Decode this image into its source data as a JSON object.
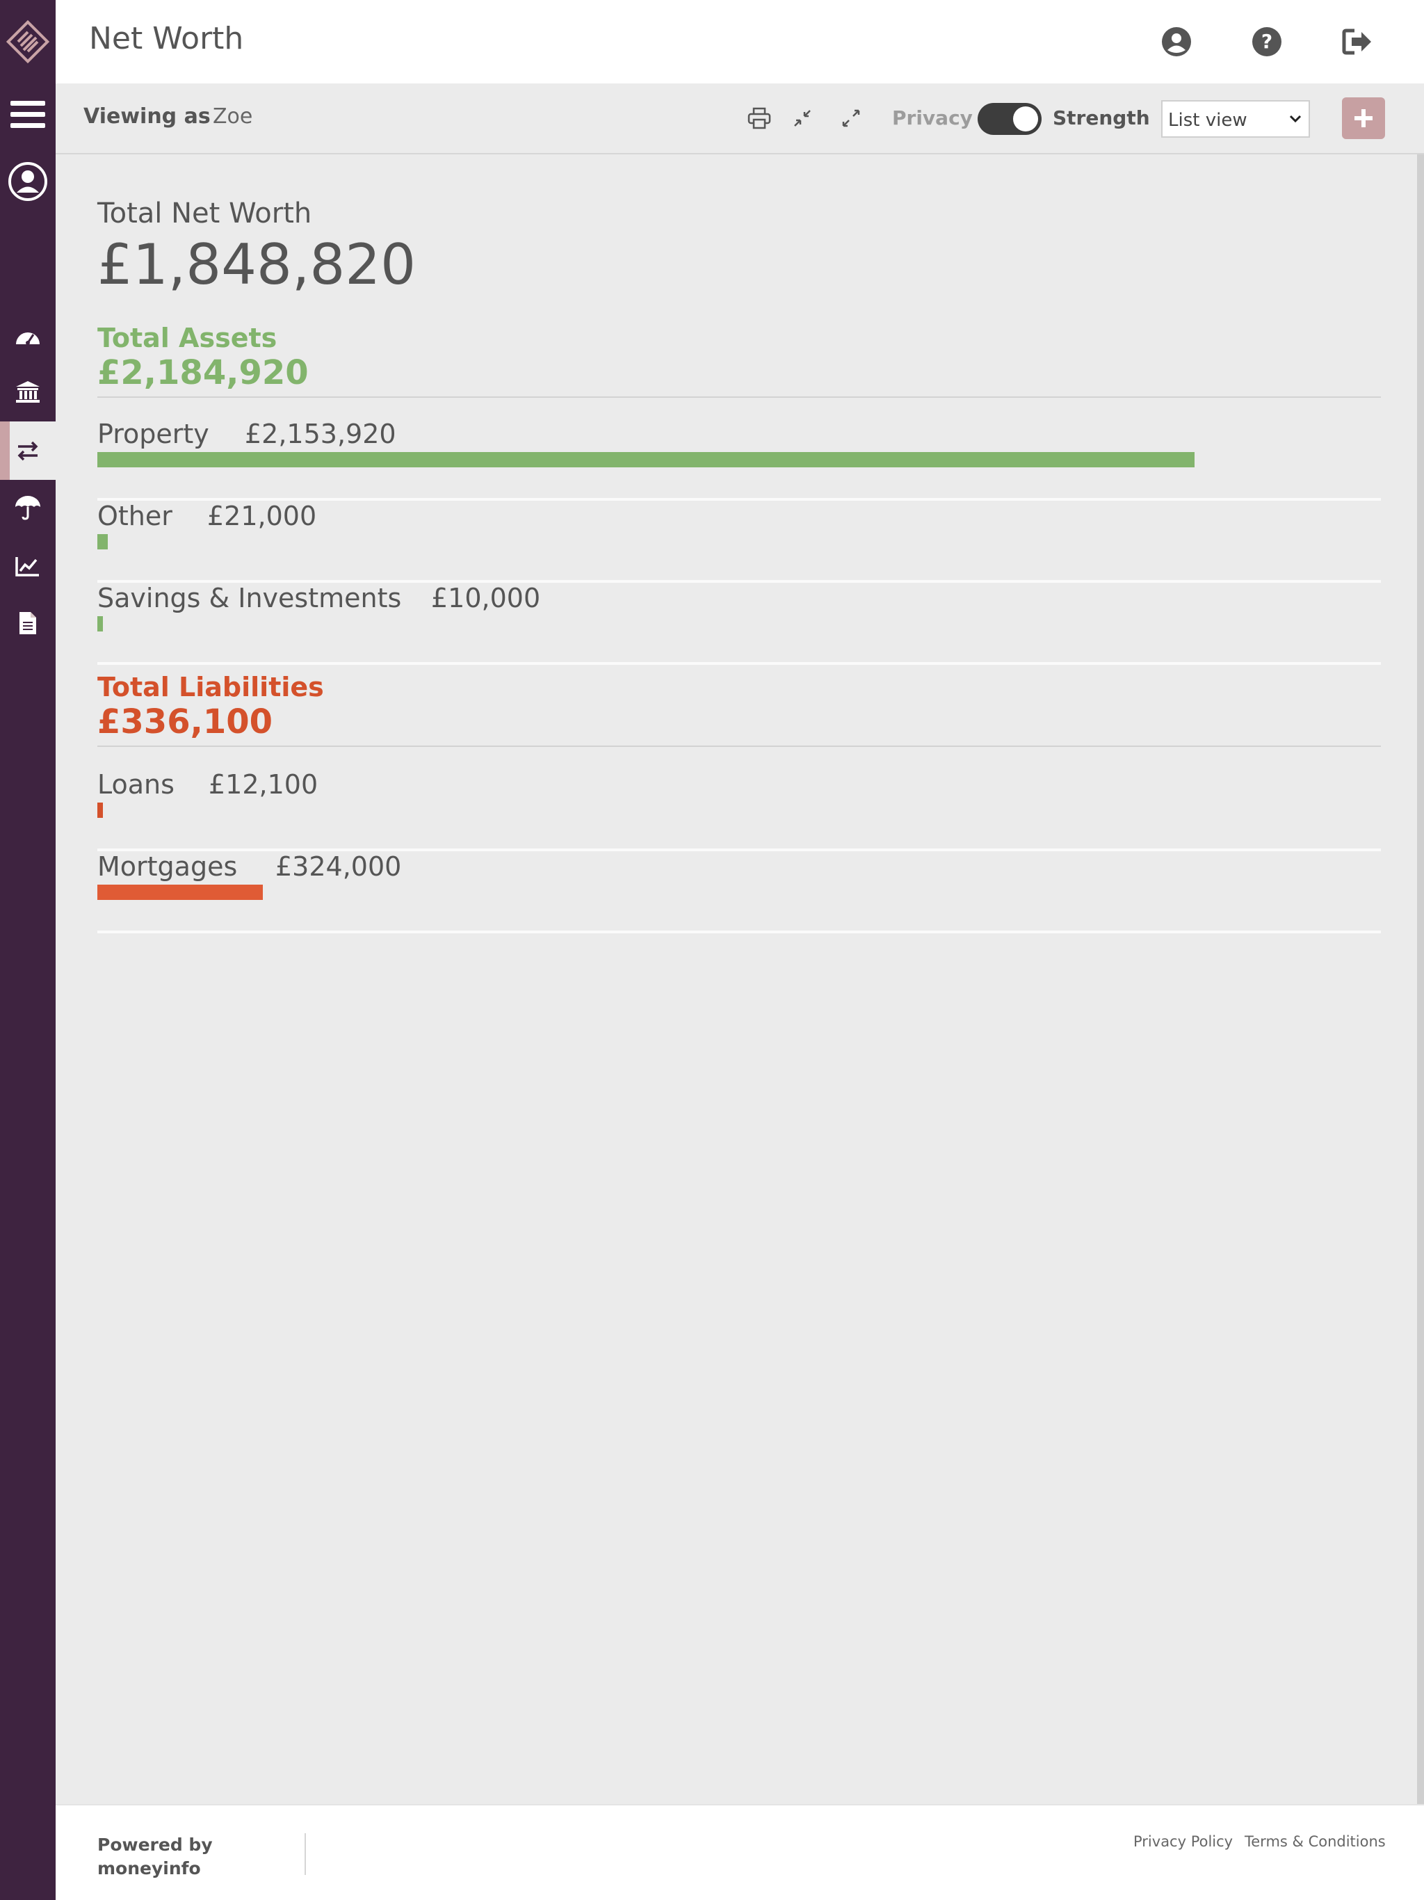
{
  "header": {
    "title": "Net Worth",
    "icons": [
      "user-circle-icon",
      "help-circle-icon",
      "sign-out-icon"
    ]
  },
  "sidebar": {
    "items": [
      {
        "name": "menu",
        "icon": "hamburger-icon"
      },
      {
        "name": "profile",
        "icon": "user-icon"
      },
      {
        "name": "dashboard",
        "icon": "dashboard-icon"
      },
      {
        "name": "banking",
        "icon": "bank-icon"
      },
      {
        "name": "net-worth",
        "icon": "transfer-icon",
        "active": true
      },
      {
        "name": "protection",
        "icon": "umbrella-icon"
      },
      {
        "name": "investments",
        "icon": "chart-line-icon"
      },
      {
        "name": "documents",
        "icon": "document-icon"
      }
    ]
  },
  "toolbar": {
    "viewing_label": "Viewing as",
    "viewing_name": "Zoe",
    "privacy_label": "Privacy",
    "privacy_on": true,
    "strength_label": "Strength",
    "view_select": "List view"
  },
  "summary": {
    "net_worth_label": "Total Net Worth",
    "net_worth_value": "£1,848,820"
  },
  "assets": {
    "title": "Total Assets",
    "total": "£2,184,920",
    "color": "#82b46c",
    "items": [
      {
        "label": "Property",
        "amount": "£2,153,920",
        "fill": 0.855
      },
      {
        "label": "Other",
        "amount": "£21,000",
        "fill": 0.008
      },
      {
        "label": "Savings & Investments",
        "amount": "£10,000",
        "fill": 0.004
      }
    ]
  },
  "liabilities": {
    "title": "Total Liabilities",
    "total": "£336,100",
    "color": "#d4512b",
    "items": [
      {
        "label": "Loans",
        "amount": "£12,100",
        "fill": 0.004
      },
      {
        "label": "Mortgages",
        "amount": "£324,000",
        "fill": 0.129
      }
    ]
  },
  "footer": {
    "powered_line1": "Powered by",
    "powered_line2": "moneyinfo",
    "privacy": "Privacy Policy",
    "terms": "Terms & Conditions"
  }
}
